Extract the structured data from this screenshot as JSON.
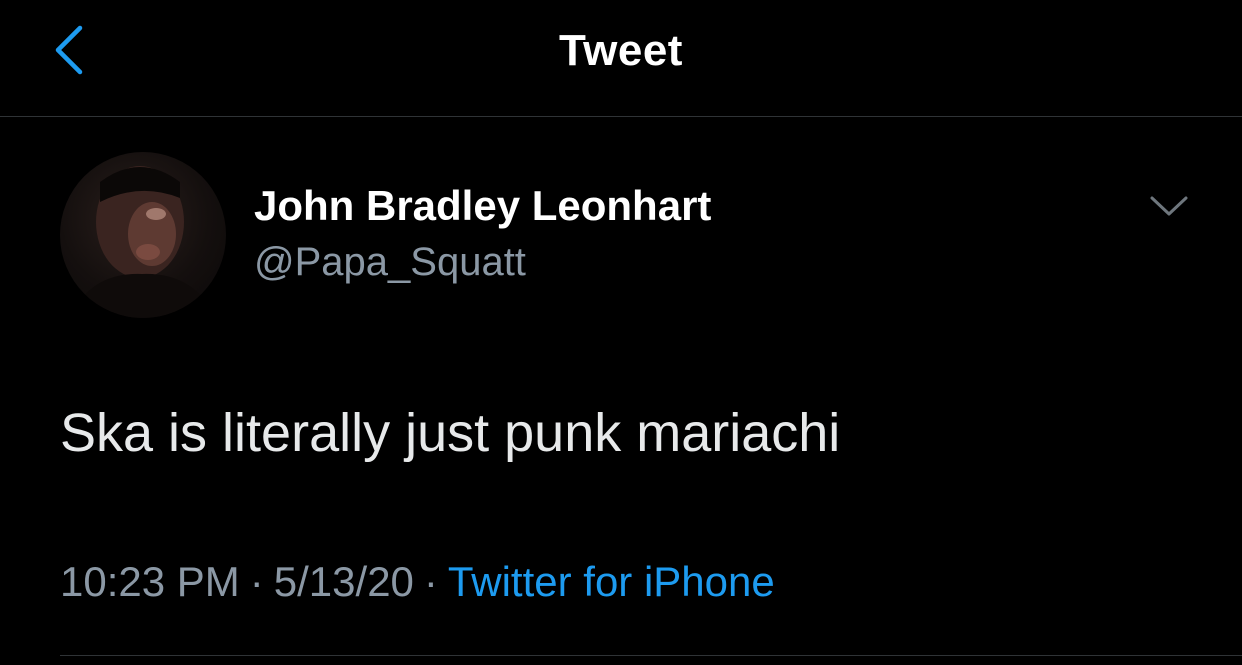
{
  "nav": {
    "title": "Tweet",
    "back_icon": "chevron-left-icon"
  },
  "author": {
    "display_name": "John Bradley Leonhart",
    "handle": "@Papa_Squatt",
    "more_icon": "chevron-down-icon"
  },
  "tweet": {
    "text": "Ska is literally just punk mariachi",
    "time": "10:23 PM",
    "date": "5/13/20",
    "source": "Twitter for iPhone",
    "separator": "·"
  },
  "colors": {
    "background": "#000000",
    "accent": "#1d9bf0",
    "secondary_text": "#8b98a5",
    "primary_text": "#e7e9ea",
    "divider": "#2f3336"
  }
}
